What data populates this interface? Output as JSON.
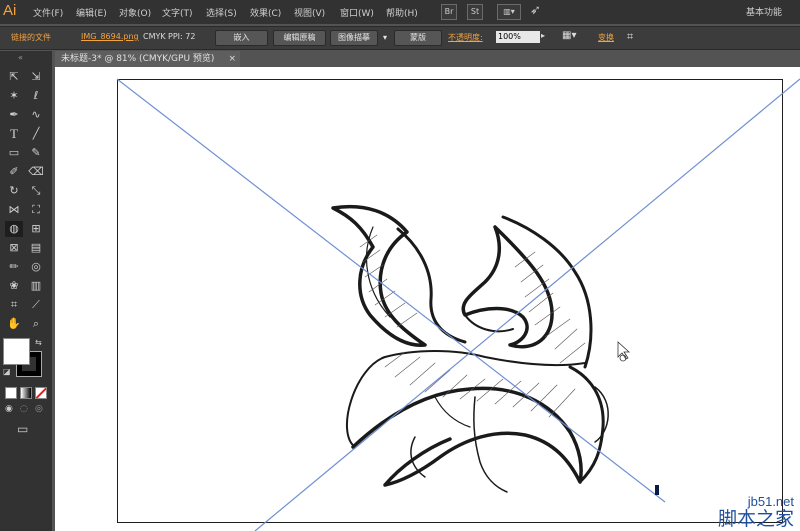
{
  "app": {
    "logo": "Ai"
  },
  "menus": [
    {
      "id": "file",
      "label": "文件(F)"
    },
    {
      "id": "edit",
      "label": "编辑(E)"
    },
    {
      "id": "object",
      "label": "对象(O)"
    },
    {
      "id": "type",
      "label": "文字(T)"
    },
    {
      "id": "select",
      "label": "选择(S)"
    },
    {
      "id": "effect",
      "label": "效果(C)"
    },
    {
      "id": "view",
      "label": "视图(V)"
    },
    {
      "id": "window",
      "label": "窗口(W)"
    },
    {
      "id": "help",
      "label": "帮助(H)"
    }
  ],
  "menubar": {
    "br_label": "Br",
    "stock_label": "St",
    "workspace": "基本功能"
  },
  "control": {
    "linked_file": "链接的文件",
    "filename": "IMG_8694.png",
    "color_mode": "CMYK",
    "ppi": "PPI: 72",
    "embed": "嵌入",
    "edit_original": "编辑原稿",
    "image_trace": "图像描摹",
    "mask": "蒙版",
    "opacity_label": "不透明度:",
    "opacity_value": "100%",
    "transform": "变换"
  },
  "doc_tab": {
    "title": "未标题-3* @ 81% (CMYK/GPU 预览)",
    "close": "×"
  },
  "tools": [
    "selection-tool",
    "direct-selection-tool",
    "magic-wand-tool",
    "lasso-tool",
    "pen-tool",
    "curvature-tool",
    "type-tool",
    "line-tool",
    "rectangle-tool",
    "paintbrush-tool",
    "blob-brush-tool",
    "eraser-tool",
    "rotate-tool",
    "scale-tool",
    "width-tool",
    "free-transform-tool",
    "shape-builder-tool",
    "perspective-grid-tool",
    "mesh-tool",
    "gradient-tool",
    "eyedropper-tool",
    "blend-tool",
    "symbol-sprayer-tool",
    "column-graph-tool",
    "artboard-tool",
    "slice-tool",
    "hand-tool",
    "zoom-tool"
  ],
  "colors": {
    "accent": "#f5a33c",
    "line": "#6f8fd2"
  },
  "watermark": {
    "url": "jb51.net",
    "text": "脚本之家"
  }
}
